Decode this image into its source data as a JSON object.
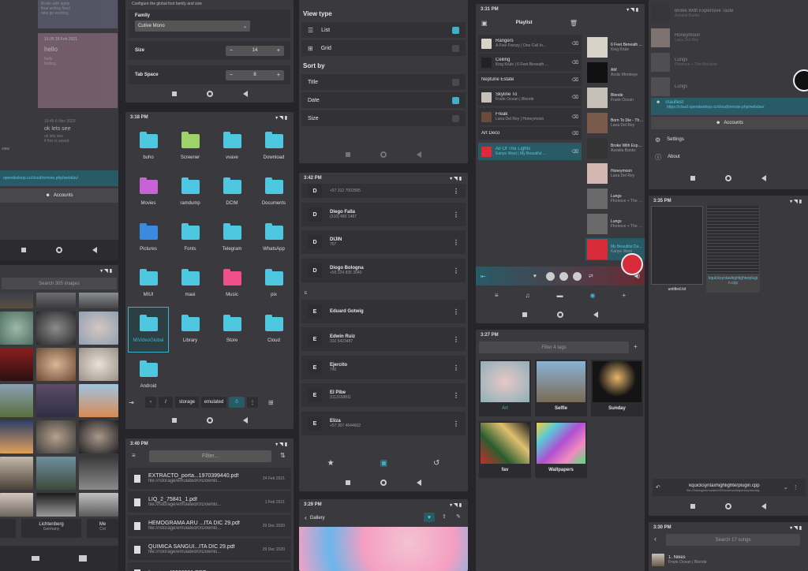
{
  "notes": {
    "top_note": [
      "Broke with lights",
      "final writing fixed",
      "new go working"
    ],
    "note2": {
      "date": "15:35 18 Feb 2021",
      "title": "hello",
      "lines": [
        "hello",
        "testing"
      ]
    },
    "note3": {
      "date": "16:45 6 Nov 2020",
      "title": "ok lets see",
      "lines": [
        "ok lets see",
        "if this is saved"
      ]
    },
    "side": "view",
    "url": "opendesktop.cc/cloud/remote.php/webdav/",
    "accounts": "Accounts"
  },
  "editor_settings": {
    "desc": "Configure the global font family and size",
    "family_label": "Family",
    "family_value": "Cutive Mono",
    "size_label": "Size",
    "size_value": "14",
    "tab_label": "Tab Space",
    "tab_value": "8",
    "minus": "−",
    "plus": "+"
  },
  "view_settings": {
    "view_type": "View type",
    "list": "List",
    "grid": "Grid",
    "sort_by": "Sort by",
    "title": "Title",
    "date": "Date",
    "size": "Size"
  },
  "playlist": {
    "time": "3:31 PM",
    "title": "Playlist",
    "items": [
      {
        "t": "Rangers",
        "s": "A Fine Frenzy | One Cell In..."
      },
      {
        "t": "Ceiling",
        "s": "King Krule | 6 Feet Beneath ..."
      },
      {
        "t": "Neptune Estate",
        "s": ""
      },
      {
        "t": "Skyline To",
        "s": "Frank Ocean | Blonde"
      },
      {
        "t": "Freak",
        "s": "Lana Del Rey | Honeymoon"
      },
      {
        "t": "Art Deco",
        "s": ""
      },
      {
        "t": "All Of The Lights",
        "s": "Kanye West | My Beautiful ..."
      }
    ],
    "albums": [
      {
        "t": "6 Feet Beneath ...",
        "s": "King Krule"
      },
      {
        "t": "AM",
        "s": "Arctic Monkeys"
      },
      {
        "t": "Blonde",
        "s": "Frank Ocean"
      },
      {
        "t": "Born To Die - The ...",
        "s": "Lana Del Rey"
      },
      {
        "t": "Broke With Expen...",
        "s": "Azealia Banks"
      },
      {
        "t": "Honeymoon",
        "s": "Lana Del Rey"
      },
      {
        "t": "Lungs",
        "s": "Florence + The M..."
      },
      {
        "t": "Lungs",
        "s": "Florence + The M..."
      },
      {
        "t": "My Beautiful Da...",
        "s": "Kanye West"
      }
    ]
  },
  "accounts_panel": {
    "items": [
      {
        "t": "Broke With Expensive Taste",
        "s": "Azealia Banks"
      },
      {
        "t": "Honeymoon",
        "s": "Lana Del Rey"
      },
      {
        "t": "Lungs",
        "s": "Florence + The Machine"
      },
      {
        "t": "Lungs",
        "s": ""
      }
    ],
    "user": "mauitest",
    "url": "https://cloud.opendesktop.cc/cloud/remote.php/webdav/",
    "accounts": "Accounts",
    "settings": "Settings",
    "about": "About"
  },
  "files": {
    "time": "3:18 PM",
    "folders": [
      "buho",
      "Screener",
      "vvave",
      "Download",
      "Movies",
      "ramdump",
      "DCIM",
      "Documents",
      "Pictures",
      "Fonts",
      "Telegram",
      "WhatsApp",
      "MIUI",
      "maui",
      "Music",
      "pix",
      "MiVideoGlobal",
      "Library",
      "Store",
      "Cloud",
      "Android"
    ],
    "crumbs": [
      "/",
      "storage",
      "emulated",
      "0"
    ]
  },
  "contacts": {
    "time": "3:42 PM",
    "items": [
      {
        "i": "D",
        "n": "",
        "p": "+57 312 7002505"
      },
      {
        "i": "D",
        "n": "Diego Falla",
        "p": "(310) 480 1487"
      },
      {
        "i": "D",
        "n": "DIJIN",
        "p": "707"
      },
      {
        "i": "D",
        "n": "Diogo Bologna",
        "p": "+55 224 835 3040"
      },
      {
        "i": "E",
        "n": "Eduard Gotwig",
        "p": ""
      },
      {
        "i": "E",
        "n": "Edwin Ruiz",
        "p": "310 5423487"
      },
      {
        "i": "E",
        "n": "Ejercito",
        "p": "745"
      },
      {
        "i": "E",
        "n": "El Pibe",
        "p": "3113158811"
      },
      {
        "i": "E",
        "n": "Eliza",
        "p": "+57 307 4644602"
      }
    ],
    "section_e": "E"
  },
  "gallery": {
    "search": "Search 305 images",
    "places": [
      {
        "t": "Lichtenberg",
        "s": "Germany"
      },
      {
        "t": "Me",
        "s": "Col"
      }
    ]
  },
  "tags": {
    "time": "3:27 PM",
    "filter": "Filter 4 tags",
    "items": [
      "Art",
      "Selfie",
      "Sunday",
      "fav",
      "Wallpapers"
    ]
  },
  "docs": {
    "time": "3:40 PM",
    "filter": "Filter...",
    "items": [
      {
        "t": "EXTRACTO_porta...1970399440.pdf",
        "p": "file:///storage/emulated/0/Downlo...",
        "d": "24 Feb 2021"
      },
      {
        "t": "LIQ_2_75841_1.pdf",
        "p": "file:///storage/emulated/0/Downlo...",
        "d": "1 Feb 2021"
      },
      {
        "t": "HEMOGRAMA ARU ...ITA DIC 29.pdf",
        "p": "file:///storage/emulated/0/Downlo...",
        "d": "29 Dec 2020"
      },
      {
        "t": "QUIMICA SANGUI...ITA DIC 29.pdf",
        "p": "file:///storage/emulated/0/Downlo...",
        "d": "29 Dec 2020"
      },
      {
        "t": "Invoice_40080981.PDF",
        "p": "",
        "d": ""
      }
    ]
  },
  "viewer": {
    "time": "3:29 PM",
    "back": "Gallery"
  },
  "text_files": {
    "time": "3:35 PM",
    "files": [
      "untitled.txt",
      "kquicksyntaxhighlighterplugin.cpp"
    ],
    "open": "kquicksyntaxhighlighterplugin.cpp",
    "path": "file:///storage/emulated/0/Download/kquicksyntaxhig..."
  },
  "songs": {
    "time": "3:30 PM",
    "search": "Search 17 songs",
    "first": {
      "t": "1. Nikes",
      "s": "Frank Ocean | Blonde"
    }
  }
}
